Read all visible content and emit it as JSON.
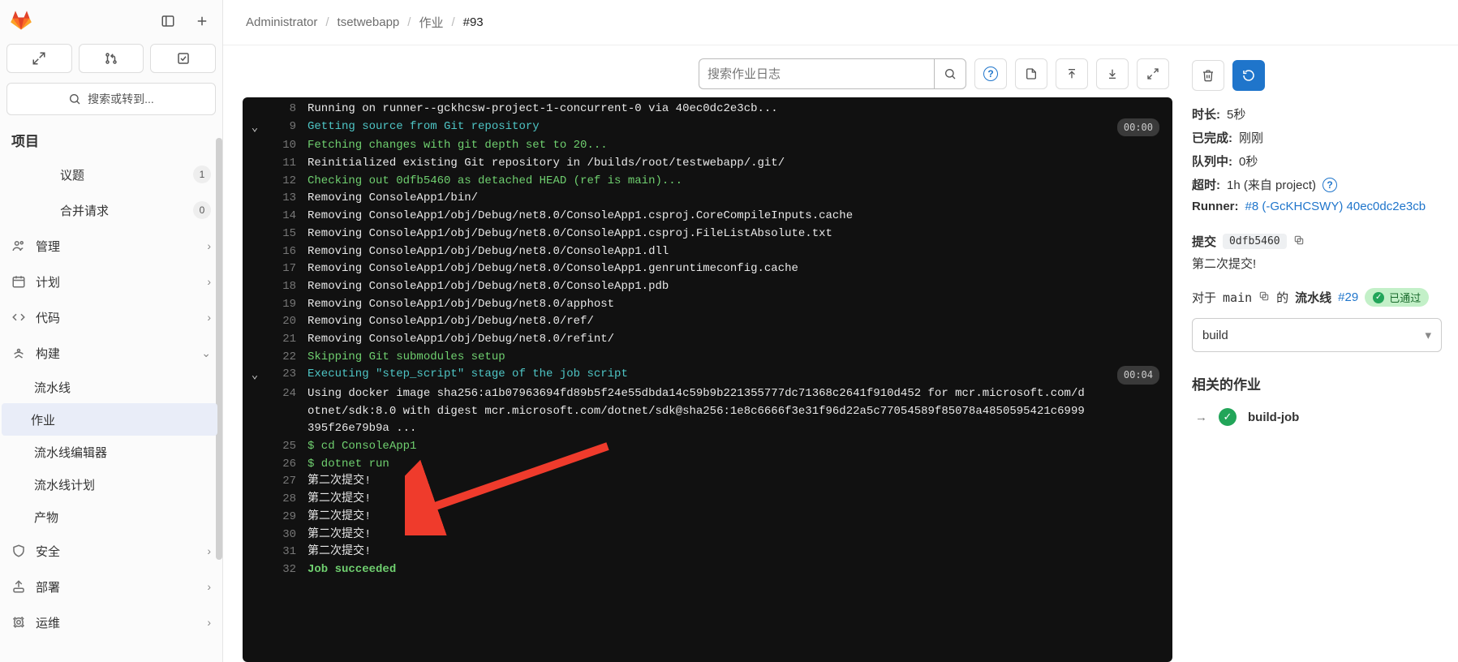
{
  "sidebar": {
    "search_label": "搜索或转到...",
    "section_title": "项目",
    "items": [
      {
        "label": "议题",
        "badge": "1"
      },
      {
        "label": "合并请求",
        "badge": "0"
      },
      {
        "label": "管理"
      },
      {
        "label": "计划"
      },
      {
        "label": "代码"
      },
      {
        "label": "构建",
        "expanded": true,
        "children": [
          {
            "label": "流水线"
          },
          {
            "label": "作业",
            "active": true
          },
          {
            "label": "流水线编辑器"
          },
          {
            "label": "流水线计划"
          },
          {
            "label": "产物"
          }
        ]
      },
      {
        "label": "安全"
      },
      {
        "label": "部署"
      },
      {
        "label": "运维"
      }
    ]
  },
  "breadcrumb": {
    "a": "Administrator",
    "b": "tsetwebapp",
    "c": "作业",
    "d": "#93"
  },
  "log_search_placeholder": "搜索作业日志",
  "log": {
    "lines": [
      {
        "n": 8,
        "c": "c-white",
        "t": "Running on runner--gckhcsw-project-1-concurrent-0 via 40ec0dc2e3cb..."
      },
      {
        "n": 9,
        "c": "c-cyan",
        "t": "Getting source from Git repository",
        "caret": true,
        "time": "00:00"
      },
      {
        "n": 10,
        "c": "c-green",
        "t": "Fetching changes with git depth set to 20..."
      },
      {
        "n": 11,
        "c": "c-white",
        "t": "Reinitialized existing Git repository in /builds/root/testwebapp/.git/"
      },
      {
        "n": 12,
        "c": "c-green",
        "t": "Checking out 0dfb5460 as detached HEAD (ref is main)..."
      },
      {
        "n": 13,
        "c": "c-white",
        "t": "Removing ConsoleApp1/bin/"
      },
      {
        "n": 14,
        "c": "c-white",
        "t": "Removing ConsoleApp1/obj/Debug/net8.0/ConsoleApp1.csproj.CoreCompileInputs.cache"
      },
      {
        "n": 15,
        "c": "c-white",
        "t": "Removing ConsoleApp1/obj/Debug/net8.0/ConsoleApp1.csproj.FileListAbsolute.txt"
      },
      {
        "n": 16,
        "c": "c-white",
        "t": "Removing ConsoleApp1/obj/Debug/net8.0/ConsoleApp1.dll"
      },
      {
        "n": 17,
        "c": "c-white",
        "t": "Removing ConsoleApp1/obj/Debug/net8.0/ConsoleApp1.genruntimeconfig.cache"
      },
      {
        "n": 18,
        "c": "c-white",
        "t": "Removing ConsoleApp1/obj/Debug/net8.0/ConsoleApp1.pdb"
      },
      {
        "n": 19,
        "c": "c-white",
        "t": "Removing ConsoleApp1/obj/Debug/net8.0/apphost"
      },
      {
        "n": 20,
        "c": "c-white",
        "t": "Removing ConsoleApp1/obj/Debug/net8.0/ref/"
      },
      {
        "n": 21,
        "c": "c-white",
        "t": "Removing ConsoleApp1/obj/Debug/net8.0/refint/"
      },
      {
        "n": 22,
        "c": "c-green",
        "t": "Skipping Git submodules setup"
      },
      {
        "n": 23,
        "c": "c-cyan",
        "t": "Executing \"step_script\" stage of the job script",
        "caret": true,
        "time": "00:04"
      },
      {
        "n": 24,
        "c": "c-white",
        "t": "Using docker image sha256:a1b07963694fd89b5f24e55dbda14c59b9b221355777dc71368c2641f910d452 for mcr.microsoft.com/dotnet/sdk:8.0 with digest mcr.microsoft.com/dotnet/sdk@sha256:1e8c6666f3e31f96d22a5c77054589f85078a4850595421c6999395f26e79b9a ..."
      },
      {
        "n": 25,
        "c": "c-green",
        "t": "$ cd ConsoleApp1"
      },
      {
        "n": 26,
        "c": "c-green",
        "t": "$ dotnet run"
      },
      {
        "n": 27,
        "c": "c-white",
        "t": "第二次提交!"
      },
      {
        "n": 28,
        "c": "c-white",
        "t": "第二次提交!"
      },
      {
        "n": 29,
        "c": "c-white",
        "t": "第二次提交!"
      },
      {
        "n": 30,
        "c": "c-white",
        "t": "第二次提交!"
      },
      {
        "n": 31,
        "c": "c-white",
        "t": "第二次提交!"
      },
      {
        "n": 32,
        "c": "c-greenb",
        "t": "Job succeeded"
      }
    ]
  },
  "side": {
    "duration_k": "时长:",
    "duration_v": "5秒",
    "finished_k": "已完成:",
    "finished_v": "刚刚",
    "queue_k": "队列中:",
    "queue_v": "0秒",
    "timeout_k": "超时:",
    "timeout_v": "1h (来自 project)",
    "runner_k": "Runner:",
    "runner_link": "#8 (-GcKHCSWY) 40ec0dc2e3cb",
    "commit_k": "提交",
    "commit_sha": "0dfb5460",
    "commit_msg": "第二次提交!",
    "pipeline_prefix": "对于",
    "pipeline_branch": "main",
    "pipeline_mid": "的",
    "pipeline_word": "流水线",
    "pipeline_num": "#29",
    "pipeline_status": "已通过",
    "stage": "build",
    "related_title": "相关的作业",
    "related_job": "build-job"
  }
}
